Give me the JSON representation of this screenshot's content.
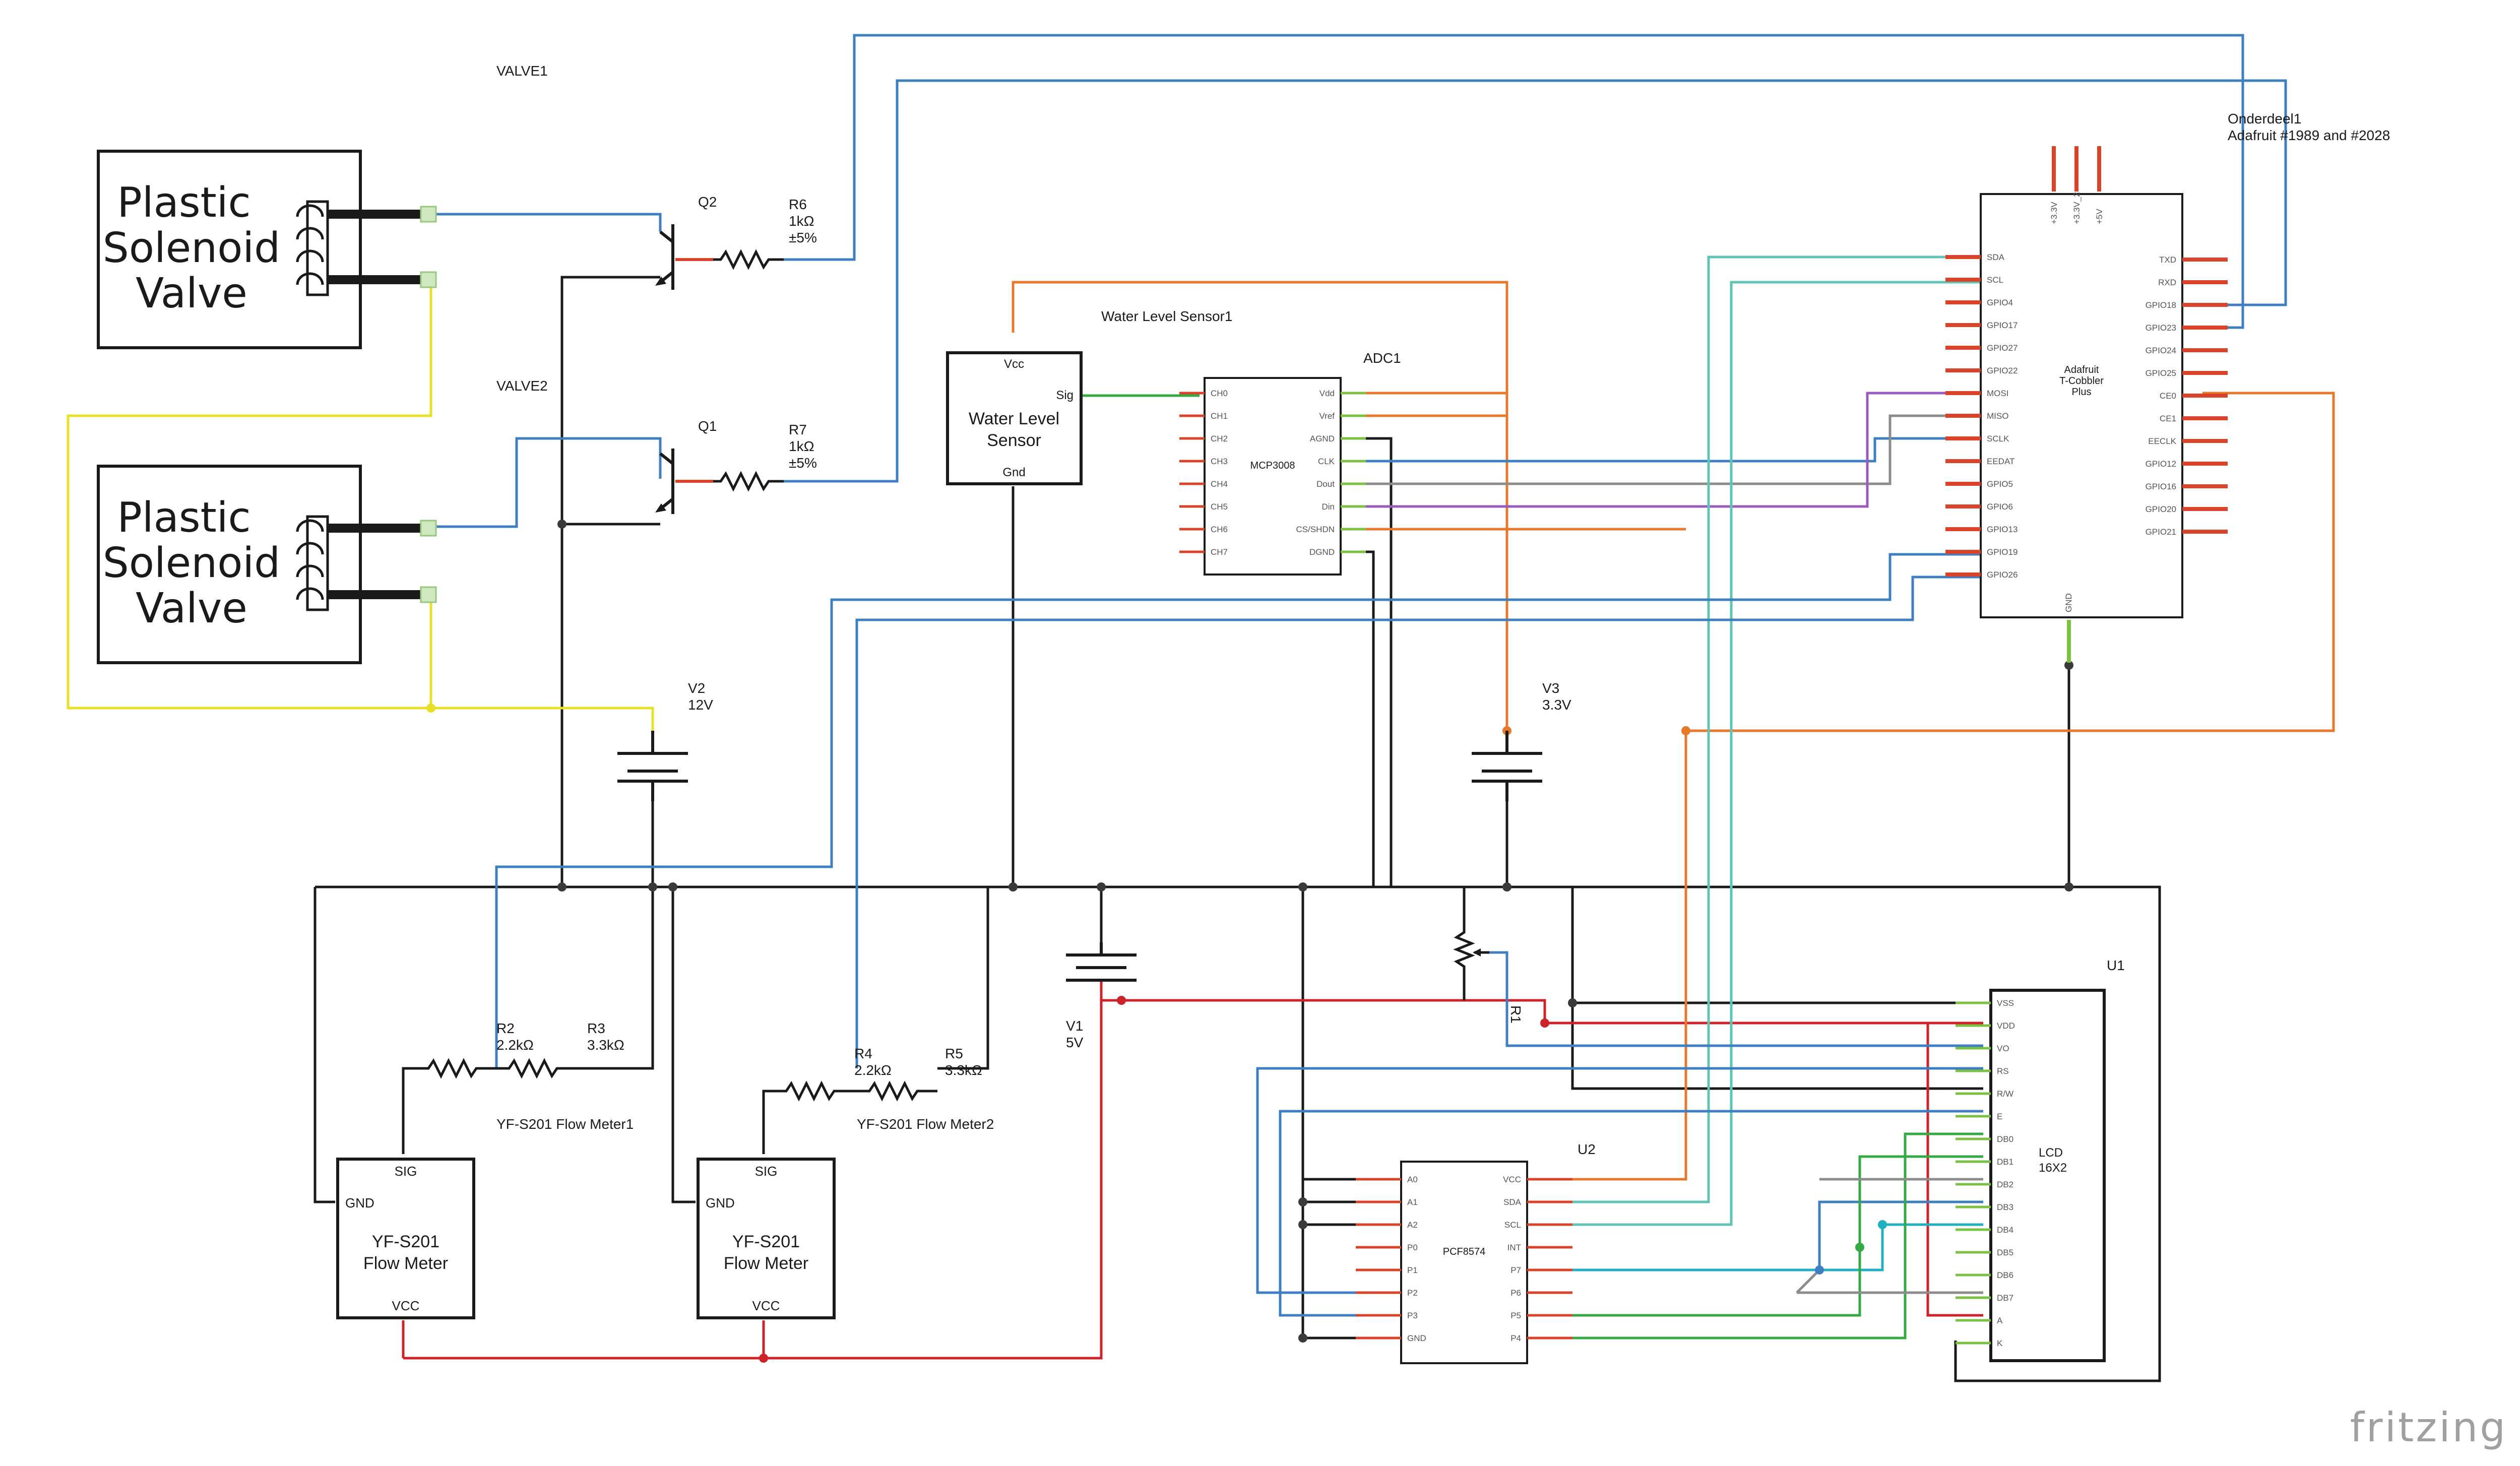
{
  "colors": {
    "blue": "#3d7fc1",
    "yellow": "#e8e028",
    "orange": "#e8782a",
    "red": "#cc2229",
    "teal": "#5fc4b4",
    "gray": "#8c8c8c",
    "purple": "#9a5bbf",
    "green": "#33aa44",
    "cyan": "#20b0c0",
    "black": "#1a1a1a",
    "pinRed": "#d9432a",
    "pinGreen": "#7cc242"
  },
  "valves": [
    {
      "label": "VALVE1",
      "text": [
        "Plastic",
        "Solenoid",
        "Valve"
      ]
    },
    {
      "label": "VALVE2",
      "text": [
        "Plastic",
        "Solenoid",
        "Valve"
      ]
    }
  ],
  "transistors": [
    {
      "ref": "Q2"
    },
    {
      "ref": "Q1"
    }
  ],
  "resistors": [
    {
      "ref": "R6",
      "value": "1kΩ",
      "tol": "±5%"
    },
    {
      "ref": "R7",
      "value": "1kΩ",
      "tol": "±5%"
    },
    {
      "ref": "R2",
      "value": "2.2kΩ"
    },
    {
      "ref": "R3",
      "value": "3.3kΩ"
    },
    {
      "ref": "R4",
      "value": "2.2kΩ"
    },
    {
      "ref": "R5",
      "value": "3.3kΩ"
    },
    {
      "ref": "R1"
    }
  ],
  "sources": [
    {
      "ref": "V2",
      "value": "12V"
    },
    {
      "ref": "V3",
      "value": "3.3V"
    },
    {
      "ref": "V1",
      "value": "5V"
    }
  ],
  "waterSensor": {
    "ref": "Water Level Sensor1",
    "name": [
      "Water Level",
      "Sensor"
    ],
    "pins": {
      "vcc": "Vcc",
      "sig": "Sig",
      "gnd": "Gnd"
    }
  },
  "adc": {
    "ref": "ADC1",
    "chip": "MCP3008",
    "left": [
      "CH0",
      "CH1",
      "CH2",
      "CH3",
      "CH4",
      "CH5",
      "CH6",
      "CH7"
    ],
    "right": [
      "Vdd",
      "Vref",
      "AGND",
      "CLK",
      "Dout",
      "Din",
      "CS/SHDN",
      "DGND"
    ]
  },
  "cobbler": {
    "ref": "Onderdeel1",
    "sub": "Adafruit #1989 and #2028",
    "name": [
      "Adafruit",
      "T-Cobbler",
      "Plus"
    ],
    "top": [
      "+3.3V",
      "+3.3V_2",
      "+5V"
    ],
    "left": [
      "SDA",
      "SCL",
      "GPIO4",
      "GPIO17",
      "GPIO27",
      "GPIO22",
      "MOSI",
      "MISO",
      "SCLK",
      "EEDAT",
      "GPIO5",
      "GPIO6",
      "GPIO13",
      "GPIO19",
      "GPIO26"
    ],
    "right": [
      "TXD",
      "RXD",
      "GPIO18",
      "GPIO23",
      "GPIO24",
      "GPIO25",
      "CE0",
      "CE1",
      "EECLK",
      "GPIO12",
      "GPIO16",
      "GPIO20",
      "GPIO21"
    ],
    "bottom": "GND"
  },
  "lcd": {
    "ref": "U1",
    "name": [
      "LCD",
      "16X2"
    ],
    "pins": [
      "VSS",
      "VDD",
      "VO",
      "RS",
      "R/W",
      "E",
      "DB0",
      "DB1",
      "DB2",
      "DB3",
      "DB4",
      "DB5",
      "DB6",
      "DB7",
      "A",
      "K"
    ]
  },
  "pcf": {
    "ref": "U2",
    "chip": "PCF8574",
    "left": [
      "A0",
      "A1",
      "A2",
      "P0",
      "P1",
      "P2",
      "P3",
      "GND"
    ],
    "right": [
      "VCC",
      "SDA",
      "SCL",
      "INT",
      "P7",
      "P6",
      "P5",
      "P4"
    ]
  },
  "flowMeters": [
    {
      "ref": "YF-S201 Flow Meter1",
      "name": [
        "YF-S201",
        "Flow Meter"
      ],
      "pins": {
        "sig": "SIG",
        "gnd": "GND",
        "vcc": "VCC"
      }
    },
    {
      "ref": "YF-S201 Flow Meter2",
      "name": [
        "YF-S201",
        "Flow Meter"
      ],
      "pins": {
        "sig": "SIG",
        "gnd": "GND",
        "vcc": "VCC"
      }
    }
  ],
  "logo": "fritzing"
}
